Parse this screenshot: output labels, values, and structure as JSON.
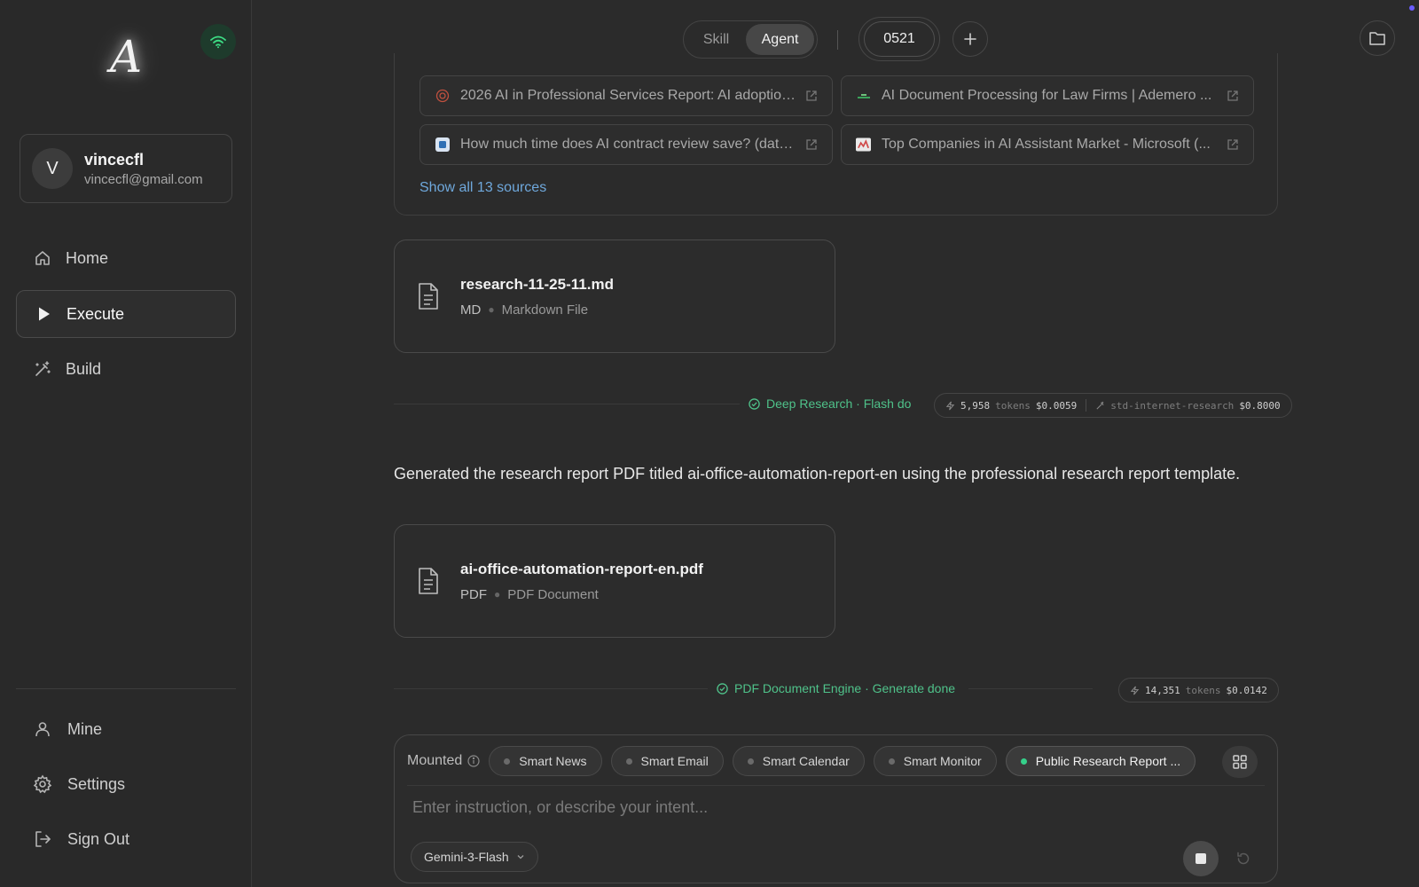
{
  "app": {
    "logo_letter": "A"
  },
  "user": {
    "initial": "V",
    "name": "vincecfl",
    "email": "vincecfl@gmail.com"
  },
  "nav": {
    "items": [
      {
        "label": "Home",
        "icon": "home-icon",
        "active": false
      },
      {
        "label": "Execute",
        "icon": "play-icon",
        "active": true
      },
      {
        "label": "Build",
        "icon": "magic-wand-icon",
        "active": false
      }
    ],
    "bottom": [
      {
        "label": "Mine",
        "icon": "user-icon"
      },
      {
        "label": "Settings",
        "icon": "gear-icon"
      },
      {
        "label": "Sign Out",
        "icon": "sign-out-icon"
      }
    ]
  },
  "topbar": {
    "mode_skill": "Skill",
    "mode_agent": "Agent",
    "active_mode": "Agent",
    "session_id": "0521"
  },
  "sources": {
    "items": [
      {
        "title": "2026 AI in Professional Services Report: AI adoption...",
        "icon": "globe-icon"
      },
      {
        "title": "AI Document Processing for Law Firms | Ademero ...",
        "icon": "site-icon"
      },
      {
        "title": "How much time does AI contract review save? (data...",
        "icon": "site-icon"
      },
      {
        "title": "Top Companies in AI Assistant Market - Microsoft (...",
        "icon": "site-icon"
      }
    ],
    "show_all": "Show all 13 sources"
  },
  "files": [
    {
      "name": "research-11-25-11.md",
      "ext": "MD",
      "type": "Markdown File"
    },
    {
      "name": "ai-office-automation-report-en.pdf",
      "ext": "PDF",
      "type": "PDF Document"
    }
  ],
  "status1": {
    "text": "Deep Research · Flash do",
    "tokens": "5,958",
    "tokens_label": "tokens",
    "cost": "$0.0059",
    "tool": "std-internet-research",
    "tool_cost": "$0.8000"
  },
  "message": "Generated the research report PDF titled ai-office-automation-report-en using the professional research report template.",
  "status2": {
    "text": "PDF Document Engine · Generate done",
    "tokens": "14,351",
    "tokens_label": "tokens",
    "cost": "$0.0142"
  },
  "composer": {
    "mounted_label": "Mounted",
    "chips": [
      {
        "label": "Smart News",
        "active": false
      },
      {
        "label": "Smart Email",
        "active": false
      },
      {
        "label": "Smart Calendar",
        "active": false
      },
      {
        "label": "Smart Monitor",
        "active": false
      },
      {
        "label": "Public Research Report ...",
        "active": true
      }
    ],
    "placeholder": "Enter instruction, or describe your intent...",
    "model": "Gemini-3-Flash"
  },
  "colors": {
    "accent_green": "#4fc28a",
    "link_blue": "#6fa8dc",
    "background": "#2b2b2b"
  }
}
